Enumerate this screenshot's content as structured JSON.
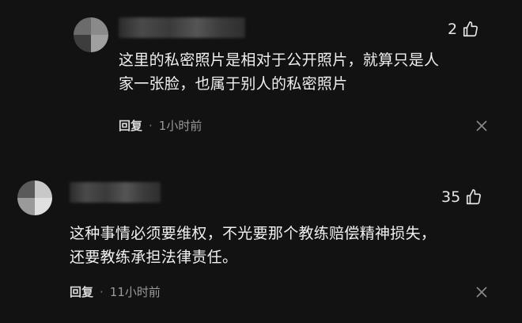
{
  "comments": [
    {
      "likes": "2",
      "text_line1": "这里的私密照片是相对于公开照片，就算只是人",
      "text_line2": "家一张脸，也属于别人的私密照片",
      "reply_label": "回复",
      "separator": "·",
      "time": "1小时前"
    },
    {
      "likes": "35",
      "text_line1": "这种事情必须要维权，不光要那个教练赔偿精神损失，",
      "text_line2": "还要教练承担法律责任。",
      "reply_label": "回复",
      "separator": "·",
      "time": "11小时前"
    }
  ],
  "icons": {
    "like": "thumbs-up-icon",
    "close": "close-icon"
  },
  "colors": {
    "background": "#121212",
    "text": "#f0f0f0",
    "meta": "#9a9a9a"
  }
}
